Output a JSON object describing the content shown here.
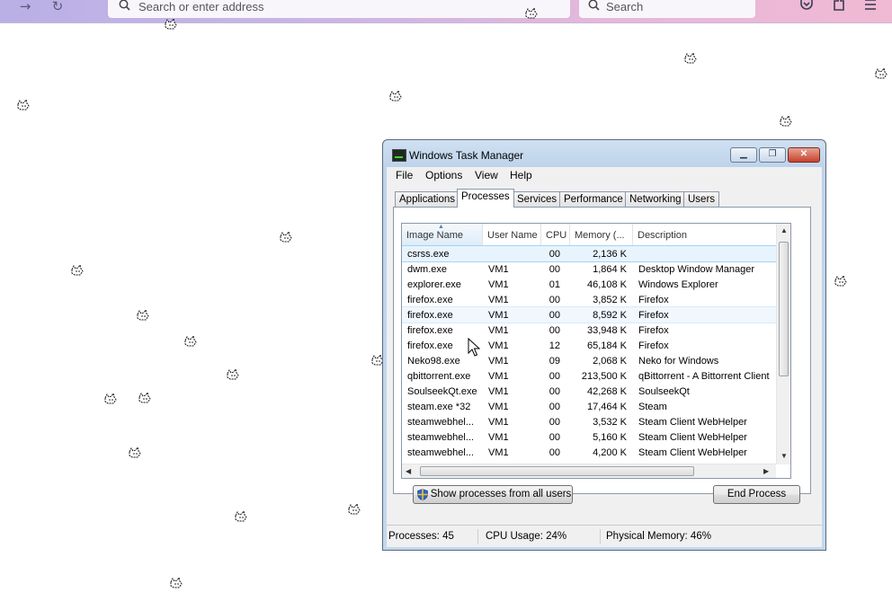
{
  "browser": {
    "address_placeholder": "Search or enter address",
    "search_placeholder": "Search"
  },
  "task_manager": {
    "title": "Windows Task Manager",
    "menu": [
      "File",
      "Options",
      "View",
      "Help"
    ],
    "tabs": [
      "Applications",
      "Processes",
      "Services",
      "Performance",
      "Networking",
      "Users"
    ],
    "active_tab": "Processes",
    "columns": [
      "Image Name",
      "User Name",
      "CPU",
      "Memory (...",
      "Description"
    ],
    "sorted_column": "Image Name",
    "rows": [
      {
        "name": "csrss.exe",
        "user": "",
        "cpu": "00",
        "mem": "2,136 K",
        "desc": ""
      },
      {
        "name": "dwm.exe",
        "user": "VM1",
        "cpu": "00",
        "mem": "1,864 K",
        "desc": "Desktop Window Manager"
      },
      {
        "name": "explorer.exe",
        "user": "VM1",
        "cpu": "01",
        "mem": "46,108 K",
        "desc": "Windows Explorer"
      },
      {
        "name": "firefox.exe",
        "user": "VM1",
        "cpu": "00",
        "mem": "3,852 K",
        "desc": "Firefox"
      },
      {
        "name": "firefox.exe",
        "user": "VM1",
        "cpu": "00",
        "mem": "8,592 K",
        "desc": "Firefox"
      },
      {
        "name": "firefox.exe",
        "user": "VM1",
        "cpu": "00",
        "mem": "33,948 K",
        "desc": "Firefox"
      },
      {
        "name": "firefox.exe",
        "user": "VM1",
        "cpu": "12",
        "mem": "65,184 K",
        "desc": "Firefox"
      },
      {
        "name": "Neko98.exe",
        "user": "VM1",
        "cpu": "09",
        "mem": "2,068 K",
        "desc": "Neko for Windows"
      },
      {
        "name": "qbittorrent.exe",
        "user": "VM1",
        "cpu": "00",
        "mem": "213,500 K",
        "desc": "qBittorrent - A Bittorrent Client"
      },
      {
        "name": "SoulseekQt.exe",
        "user": "VM1",
        "cpu": "00",
        "mem": "42,268 K",
        "desc": "SoulseekQt"
      },
      {
        "name": "steam.exe *32",
        "user": "VM1",
        "cpu": "00",
        "mem": "17,464 K",
        "desc": "Steam"
      },
      {
        "name": "steamwebhel...",
        "user": "VM1",
        "cpu": "00",
        "mem": "3,532 K",
        "desc": "Steam Client WebHelper"
      },
      {
        "name": "steamwebhel...",
        "user": "VM1",
        "cpu": "00",
        "mem": "5,160 K",
        "desc": "Steam Client WebHelper"
      },
      {
        "name": "steamwebhel...",
        "user": "VM1",
        "cpu": "00",
        "mem": "4,200 K",
        "desc": "Steam Client WebHelper"
      }
    ],
    "selected_row": 0,
    "hover_row": 4,
    "show_all_label": "Show processes from all users",
    "end_process_label": "End Process",
    "status": {
      "processes": "Processes: 45",
      "cpu": "CPU Usage: 24%",
      "memory": "Physical Memory: 46%"
    }
  },
  "colors": {
    "toolbar_start": "#b9b0e6",
    "toolbar_end": "#f0b9d4",
    "selection": "#e8f4fd",
    "close_button": "#c6422c"
  }
}
